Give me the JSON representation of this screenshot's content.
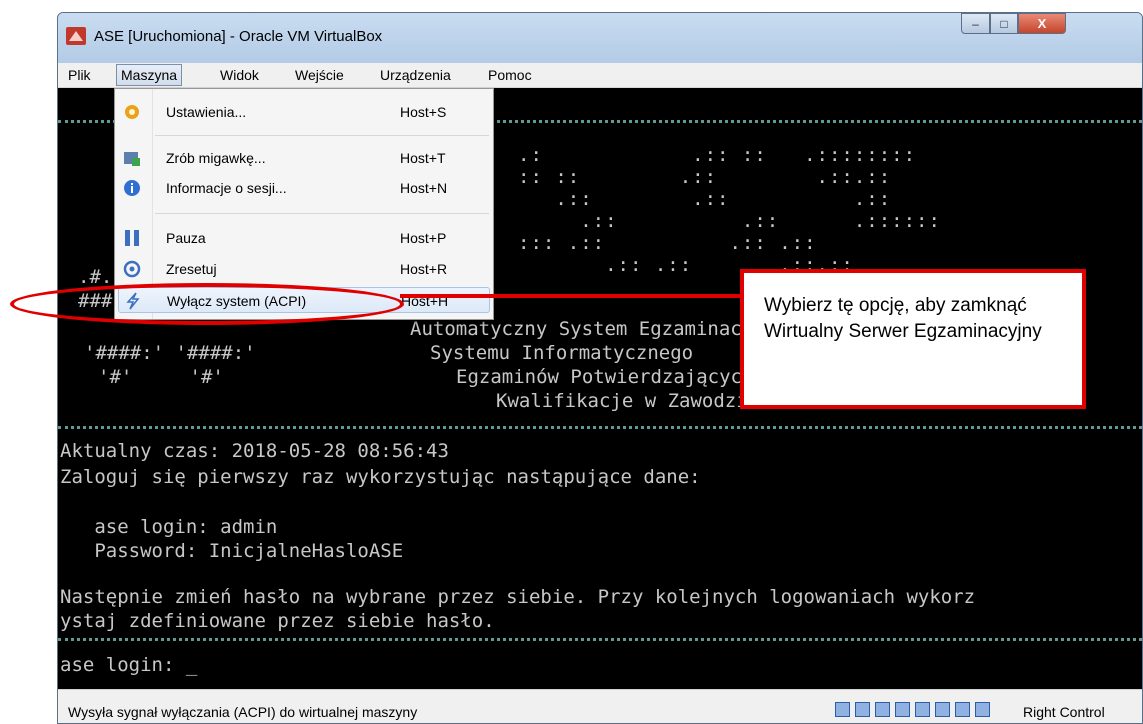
{
  "window": {
    "title": "ASE [Uruchomiona] - Oracle VM VirtualBox",
    "controls": {
      "minimize": "–",
      "maximize": "□",
      "close": "X"
    }
  },
  "menubar": {
    "items": [
      "Plik",
      "Maszyna",
      "Widok",
      "Wejście",
      "Urządzenia",
      "Pomoc"
    ],
    "active": "Maszyna"
  },
  "dropdown": {
    "items": [
      {
        "label": "Ustawienia...",
        "shortcut": "Host+S",
        "icon": "settings-gear-icon"
      },
      {
        "label": "Zrób migawkę...",
        "shortcut": "Host+T",
        "icon": "snapshot-icon"
      },
      {
        "label": "Informacje o sesji...",
        "shortcut": "Host+N",
        "icon": "info-icon"
      },
      {
        "label": "Pauza",
        "shortcut": "Host+P",
        "icon": "pause-icon"
      },
      {
        "label": "Zresetuj",
        "shortcut": "Host+R",
        "icon": "reset-icon"
      },
      {
        "label": "Wyłącz system (ACPI)",
        "shortcut": "Host+H",
        "icon": "acpi-shutdown-icon",
        "highlighted": true
      }
    ]
  },
  "console": {
    "banner_lines": [
      "Automatyczny System Egzaminacyjny",
      "Systemu Informatycznego",
      "Egzaminów Potwierdzających",
      "Kwalifikacje w Zawodzie"
    ],
    "logo_lines": [
      ".#.",
      "###",
      "'####:' '####:'",
      "'#'     '#'"
    ],
    "lines": [
      "Aktualny czas: 2018-05-28 08:56:43",
      "Zaloguj się pierwszy raz wykorzystując nastąpujące dane:",
      "   ase login: admin",
      "   Password: InicjalneHasloASE",
      "Następnie zmień hasło na wybrane przez siebie. Przy kolejnych logowaniach wykorz",
      "ystaj zdefiniowane przez siebie hasło.",
      "ase login: _"
    ]
  },
  "statusbar": {
    "text": "Wysyła sygnał wyłączania (ACPI) do wirtualnej maszyny",
    "host_key": "Right Control"
  },
  "callout": {
    "text": "Wybierz tę opcję, aby zamknąć Wirtualny Serwer Egzaminacyjny"
  },
  "colors": {
    "annotation": "#e00000",
    "console_bg": "#000000",
    "console_text": "#c7c7c7",
    "separator": "#5f9a93"
  }
}
